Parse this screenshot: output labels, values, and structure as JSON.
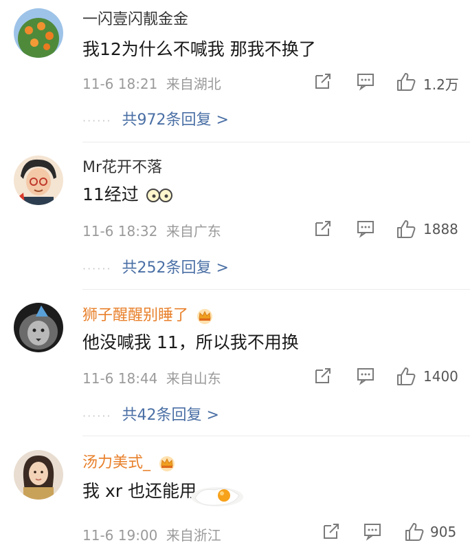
{
  "comments": [
    {
      "name": "一闪壹闪靓金金",
      "vip": false,
      "text": "我12为什么不喊我 那我不换了",
      "date": "11-6 18:21",
      "location": "来自湖北",
      "likes": "1.2万",
      "replies": "共972条回复 >"
    },
    {
      "name": "Mr花开不落",
      "vip": false,
      "text": "11经过",
      "date": "11-6 18:32",
      "location": "来自广东",
      "likes": "1888",
      "replies": "共252条回复 >"
    },
    {
      "name": "狮子醒醒别睡了",
      "vip": true,
      "text": "他没喊我 11，所以我不用换",
      "date": "11-6 18:44",
      "location": "来自山东",
      "likes": "1400",
      "replies": "共42条回复 >"
    },
    {
      "name": "汤力美式_",
      "vip": true,
      "text": "我 xr 也还能用",
      "date": "11-6 19:00",
      "location": "来自浙江",
      "likes": "905"
    }
  ],
  "colors": {
    "vip_name": "#e8802b",
    "reply_link": "#4a6fa5",
    "meta": "#9a9a9a"
  }
}
